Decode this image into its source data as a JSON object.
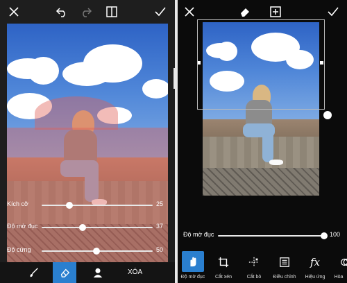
{
  "left_panel": {
    "toolbar": [
      "close-icon",
      "undo-icon",
      "redo-icon",
      "compare-icon",
      "check-icon"
    ],
    "sliders": [
      {
        "label": "Kích cỡ",
        "value": "25",
        "fraction": 0.25
      },
      {
        "label": "Độ mờ đục",
        "value": "37",
        "fraction": 0.37
      },
      {
        "label": "Độ cứng",
        "value": "50",
        "fraction": 0.5
      }
    ],
    "bottom_tools": [
      "brush-icon",
      "eraser-icon",
      "person-icon"
    ],
    "clear_label": "XÓA",
    "active_tool": "eraser-icon"
  },
  "right_panel": {
    "toolbar": [
      "close-icon",
      "eraser-icon",
      "add-icon",
      "check-icon"
    ],
    "opacity_slider": {
      "label": "Độ mờ đục",
      "value": "100",
      "fraction": 1.0
    },
    "tools": [
      {
        "label": "Độ mờ đục",
        "icon": "hand-icon",
        "active": true
      },
      {
        "label": "Cắt xén",
        "icon": "crop-icon",
        "active": false
      },
      {
        "label": "Cắt bỏ",
        "icon": "cutout-icon",
        "active": false
      },
      {
        "label": "Điều chỉnh",
        "icon": "adjust-icon",
        "active": false
      },
      {
        "label": "Hiệu ứng",
        "icon": "fx-icon",
        "active": false
      },
      {
        "label": "Hòa",
        "icon": "blend-icon",
        "active": false
      }
    ]
  },
  "colors": {
    "accent": "#2a7fcf",
    "tint": "#e15f55"
  }
}
